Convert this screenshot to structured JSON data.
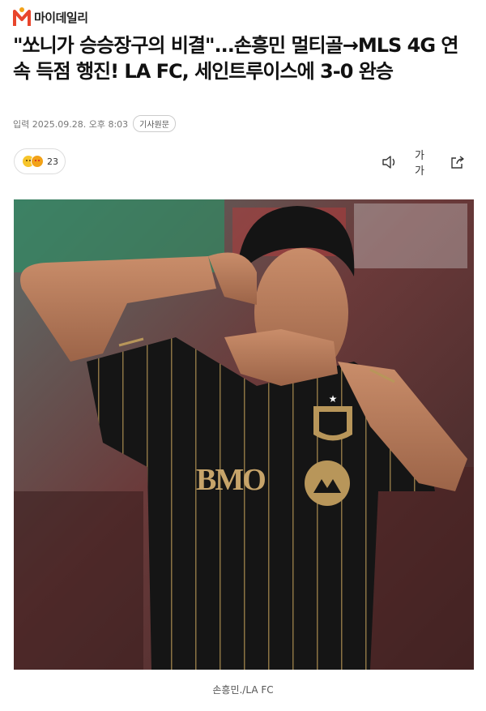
{
  "site": {
    "name": "마이데일리",
    "logo_icon": "mydaily-m-logo"
  },
  "article": {
    "title": "\"쏘니가 승승장구의 비결\"...손흥민 멀티골→MLS 4G 연속 득점 행진! LA FC, 세인트루이스에 3-0 완승",
    "date": "입력 2025.09.28. 오후 8:03",
    "source_button": "기사원문"
  },
  "reactions": {
    "count": "23",
    "icons": [
      "grinning-emoji-icon",
      "heart-eyes-emoji-icon"
    ]
  },
  "tools": [
    {
      "name": "audio-listen-icon"
    },
    {
      "name": "font-size-button",
      "label": "가가"
    },
    {
      "name": "share-icon"
    }
  ],
  "photo": {
    "jersey_sponsor": "BMO",
    "caption": "손흥민./LA FC"
  },
  "colors": {
    "accent_logo": "#e8452c",
    "jersey_black": "#141414",
    "jersey_gold": "#b8965a"
  }
}
